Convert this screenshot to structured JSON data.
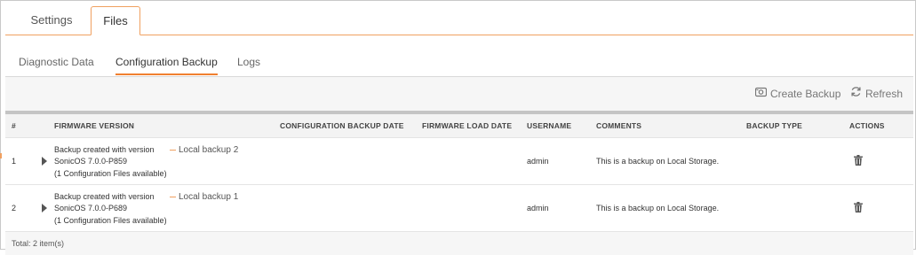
{
  "top_tabs": [
    {
      "label": "Settings",
      "active": false
    },
    {
      "label": "Files",
      "active": true
    }
  ],
  "sub_tabs": [
    {
      "label": "Diagnostic Data",
      "active": false
    },
    {
      "label": "Configuration Backup",
      "active": true
    },
    {
      "label": "Logs",
      "active": false
    }
  ],
  "toolbar": {
    "create_backup": {
      "label": "Create Backup",
      "icon": "backup-icon"
    },
    "refresh": {
      "label": "Refresh",
      "icon": "refresh-icon"
    }
  },
  "table": {
    "columns": [
      "#",
      "FIRMWARE VERSION",
      "CONFIGURATION BACKUP DATE",
      "FIRMWARE LOAD DATE",
      "USERNAME",
      "COMMENTS",
      "BACKUP TYPE",
      "ACTIONS"
    ],
    "rows": [
      {
        "index": "1",
        "firmware_line1": "Backup created with version",
        "firmware_line2": "SonicOS 7.0.0-P859",
        "firmware_line3": "(1 Configuration Files available)",
        "local_label": "Local backup 2",
        "config_backup_date": "",
        "firmware_load_date": "",
        "username": "admin",
        "comments": "This is a backup on Local Storage.",
        "backup_type": "",
        "action_icon": "trash-icon"
      },
      {
        "index": "2",
        "firmware_line1": "Backup created with version",
        "firmware_line2": "SonicOS 7.0.0-P689",
        "firmware_line3": "(1 Configuration Files available)",
        "local_label": "Local backup 1",
        "config_backup_date": "",
        "firmware_load_date": "",
        "username": "admin",
        "comments": "This is a backup on Local Storage.",
        "backup_type": "",
        "action_icon": "trash-icon"
      }
    ],
    "footer": "Total: 2 item(s)"
  },
  "colors": {
    "accent": "#f08030",
    "tab_border": "#f0a060"
  }
}
